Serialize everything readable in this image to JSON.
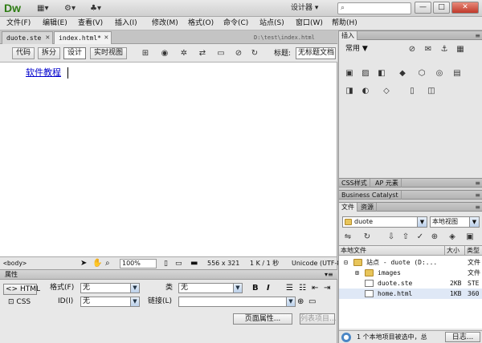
{
  "app": {
    "logo": "Dw",
    "workspace": "设计器 ▾",
    "search_placeholder": ""
  },
  "toolbar_icons": [
    "layout-icon",
    "gear-icon",
    "user-icon"
  ],
  "window_buttons": {
    "minimize": "—",
    "maximize": "□",
    "close": "✕"
  },
  "menu": [
    "文件(F)",
    "编辑(E)",
    "查看(V)",
    "插入(I)",
    "修改(M)",
    "格式(O)",
    "命令(C)",
    "站点(S)",
    "窗口(W)",
    "帮助(H)"
  ],
  "tabs": [
    {
      "label": "duote.ste",
      "close": "✕"
    },
    {
      "label": "index.html*",
      "close": "✕"
    }
  ],
  "doc_path": "D:\\test\\index.html",
  "view_buttons": [
    "代码",
    "拆分",
    "设计",
    "实时视图"
  ],
  "active_view": "设计",
  "title_label": "标题:",
  "title_value": "无标题文档",
  "design": {
    "link_text": "软件教程"
  },
  "status": {
    "tag": "<body>",
    "zoom": "100%",
    "size": "556 x 321",
    "filesize": "1 K / 1 秒",
    "encoding": "Unicode (UTF-8)"
  },
  "properties": {
    "header": "属性",
    "html_btn": "HTML",
    "css_btn": "CSS",
    "format_label": "格式(F)",
    "format_value": "无",
    "class_label": "类",
    "class_value": "无",
    "id_label": "ID(I)",
    "id_value": "无",
    "link_label": "链接(L)",
    "link_value": "",
    "bold": "B",
    "italic": "I",
    "page_props": "页面属性...",
    "list_item": "列表项目..."
  },
  "insert_panel": {
    "tab": "插入",
    "category": "常用 ▼"
  },
  "css_panel": {
    "tabs": [
      "CSS样式",
      "AP 元素"
    ]
  },
  "bc_panel": {
    "tab": "Business Catalyst"
  },
  "files_panel": {
    "tabs": [
      "文件",
      "资源"
    ],
    "site": "duote",
    "view": "本地视图",
    "columns": [
      "本地文件",
      "大小",
      "类型"
    ],
    "rows": [
      {
        "name": "站点 - duote (D:...",
        "size": "",
        "type": "文件",
        "indent": 0,
        "kind": "folder",
        "expand": "⊟"
      },
      {
        "name": "images",
        "size": "",
        "type": "文件",
        "indent": 1,
        "kind": "folder",
        "expand": "⊞"
      },
      {
        "name": "duote.ste",
        "size": "2KB",
        "type": "STE",
        "indent": 1,
        "kind": "file",
        "expand": ""
      },
      {
        "name": "home.html",
        "size": "1KB",
        "type": "360",
        "indent": 1,
        "kind": "file",
        "expand": ""
      }
    ],
    "status": "1 个本地项目被选中，总",
    "log_button": "日志..."
  }
}
